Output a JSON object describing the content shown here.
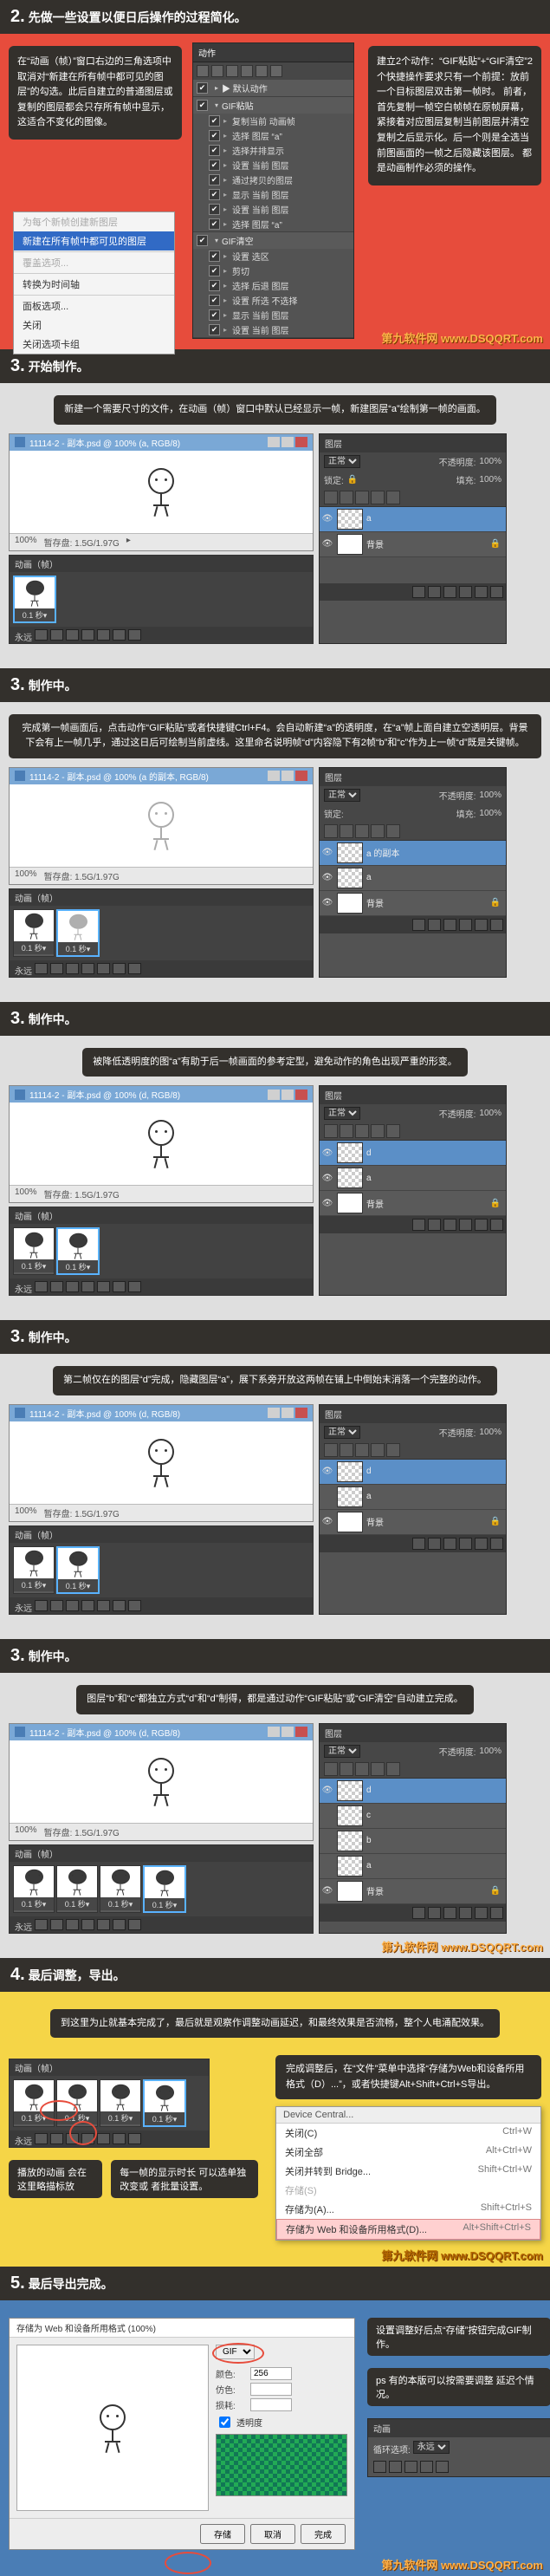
{
  "watermark": "第九软件网\nwww.DSQQRT.com",
  "step2": {
    "heading_num": "2.",
    "heading_text": "先做一些设置以便日后操作的过程简化。",
    "talk_left": "在“动画（帧）”窗口右边的三角选项中取消对“新建在所有帧中都可见的图层”的勾选。此后自建立的普通图层或复制的图层都会只存所有帧中显示，这适合不变化的图像。",
    "talk_right": "建立2个动作：“GIF粘贴”+“GIF清空”2个快捷操作要求只有一个前提：放前一个目标图层双击第一帧时。\n前者，首先复制一帧空白帧帧在原帧屏幕，紧接着对应图层复制当前图层并清空复制之后显示化。后一个则是全选当前图画面的一帧之后隐藏该图层。\n都是动画制作必须的操作。",
    "ctx": {
      "i1": "为每个新帧创建新图层",
      "i2": "新建在所有帧中都可见的图层",
      "i3": "覆盖选项...",
      "i4": "转换为时间轴",
      "i5": "面板选项...",
      "i6": "关闭",
      "i7": "关闭选项卡组"
    },
    "actions": {
      "tab": "▶ 默认动作",
      "set1": "GIF粘贴",
      "set2": "GIF清空",
      "a1": "复制当前 动画帧",
      "a2": "选择 图层 “a”",
      "a3": "选择并排显示",
      "a4": "设置 当前 图层",
      "a5": "通过拷贝的图层",
      "a6": "显示 当前 图层",
      "a7": "设置 当前 图层",
      "a8": "选择 图层 “a”",
      "b1": "设置 选区",
      "b2": "剪切",
      "b3": "选择 后退 图层",
      "b4": "设置 所选 不选择",
      "b5": "显示 当前 图层",
      "b6": "设置 当前 图层"
    }
  },
  "step3": {
    "heading_num": "3.",
    "heading_text0": "开始制作。",
    "heading_text1": "制作中。",
    "heading_text2": "制作中。",
    "heading_text3": "制作中。",
    "heading_text4": "制作中。",
    "note0": "新建一个需要尺寸的文件，在动画（帧）窗口中默认已经显示一帧，新建图层“a”绘制第一帧的画面。",
    "note1": "完成第一帧画面后，点击动作“GIF粘贴”或者快捷键Ctrl+F4。会自动新建“a”的透明度，在“a”帧上面自建立空透明层。背景下会有上一帧几乎，通过这日后可绘制当前虚线。这里命名说明帧“d”内容隐下有2帧“b”和“c”作为上一帧“d”既是关键帧。",
    "note2": "被降低透明度的图“a”有助于后一帧画面的参考定型，避免动作的角色出现严重的形变。",
    "note3": "第二帧仅在的图层“d”完成，隐藏图层“a”，展下系旁开放这两帧在铺上中倒始末消落一个完整的动作。",
    "note4": "图层“b”和“c”都独立方式“d”和“d”制得，都是通过动作“GIF粘贴”或“GIF清空”自动建立完成。",
    "doc_title": "11114-2 - 副本.psd @ 100% (a, RGB/8)",
    "doc_title2": "11114-2 - 副本.psd @ 100% (a 的副本, RGB/8)",
    "doc_title3": "11114-2 - 副本.psd @ 100% (d, RGB/8)",
    "zoom": "100%",
    "scratch": "暂存盘: 1.5G/1.97G",
    "anim_tab": "动画（帧）",
    "forever": "永远",
    "frame_time": "0.1 秒▾",
    "layers_tab": "图层",
    "mode": "正常",
    "opacity_lbl": "不透明度:",
    "opacity_val": "100%",
    "lock_lbl": "锁定:",
    "fill_lbl": "填充:",
    "layer_a": "a",
    "layer_bg": "背景",
    "layer_acopy": "a 的副本",
    "layer_d": "d",
    "layer_b": "b",
    "layer_c": "c"
  },
  "step4": {
    "heading_num": "4.",
    "heading_text": "最后调整，导出。",
    "note_top": "到这里为止就基本完成了，最后就是观察作调整动画延迟，和最终效果是否流畅，整个人电涌配效果。",
    "call1": "播放的动画\n会在这里略描标放",
    "call2": "每一帧的显示时长\n可以选单独改变或\n者批量设置。",
    "note_bot": "完成调整后，在“文件”菜单中选择“存储为Web和设备所用格式（D）...”，或者快捷键Alt+Shift+Ctrl+S导出。",
    "menu": {
      "head": "Device Central...",
      "i1": "关闭(C)",
      "s1": "Ctrl+W",
      "i2": "关闭全部",
      "s2": "Alt+Ctrl+W",
      "i3": "关闭并转到 Bridge...",
      "s3": "Shift+Ctrl+W",
      "i4": "存储(S)",
      "s4": "",
      "i5": "存储为(A)...",
      "s5": "Shift+Ctrl+S",
      "i6": "存储为 Web 和设备所用格式(D)...",
      "s6": "Alt+Shift+Ctrl+S"
    }
  },
  "step5": {
    "heading_num": "5.",
    "heading_text": "最后导出完成。",
    "note1": "设置调整好后点“存储”按钮完成GIF制作。",
    "note2": "ps 有的本版可以按需要调整 延迟个情况。",
    "export": {
      "title": "存储为 Web 和设备所用格式 (100%)",
      "format": "GIF",
      "colors_lbl": "颜色:",
      "colors_val": "256",
      "dither_lbl": "仿色:",
      "loss_lbl": "损耗:",
      "trans": "透明度",
      "anim_tab": "动画",
      "loop_lbl": "循环选项:",
      "loop_val": "永远",
      "btn_save": "存储",
      "btn_cancel": "取消",
      "btn_done": "完成"
    }
  }
}
